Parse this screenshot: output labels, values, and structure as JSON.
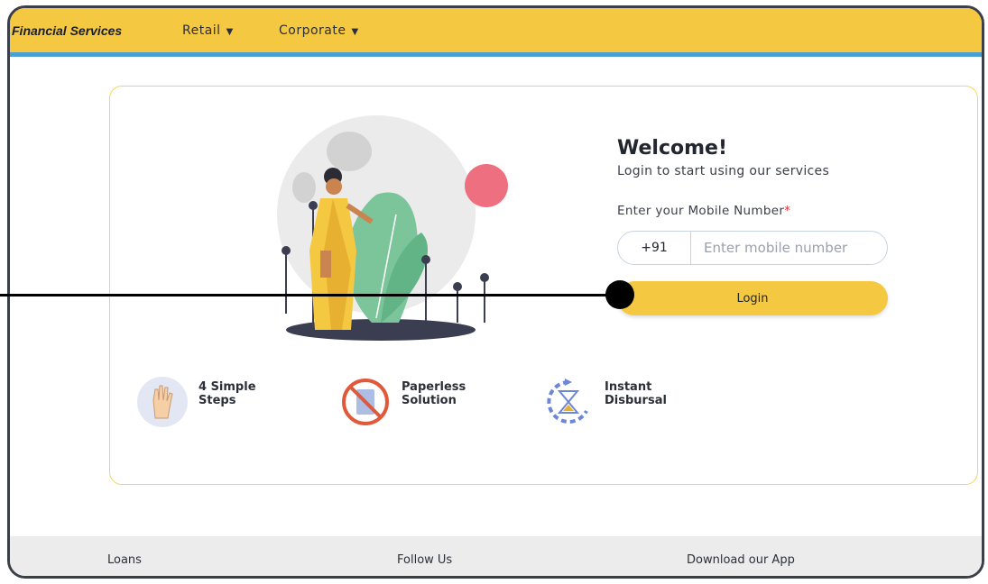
{
  "header": {
    "brand": "Financial Services",
    "nav": [
      {
        "label": "Retail"
      },
      {
        "label": "Corporate"
      }
    ]
  },
  "login": {
    "title": "Welcome!",
    "subtitle": "Login to start using our services",
    "mobile_label": "Enter your Mobile Number",
    "required_mark": "*",
    "country_code": "+91",
    "mobile_placeholder": "Enter mobile number",
    "login_button": "Login"
  },
  "features": [
    {
      "label": "4 Simple Steps",
      "icon": "hand-icon"
    },
    {
      "label": "Paperless Solution",
      "icon": "no-paper-icon"
    },
    {
      "label": "Instant Disbursal",
      "icon": "hourglass-icon"
    }
  ],
  "footer": {
    "col1": "Loans",
    "col2": "Follow Us",
    "col3": "Download our App"
  },
  "colors": {
    "brand_yellow": "#f5c842",
    "accent_blue": "#4a9fd6",
    "card_border": "#f3d36a"
  }
}
